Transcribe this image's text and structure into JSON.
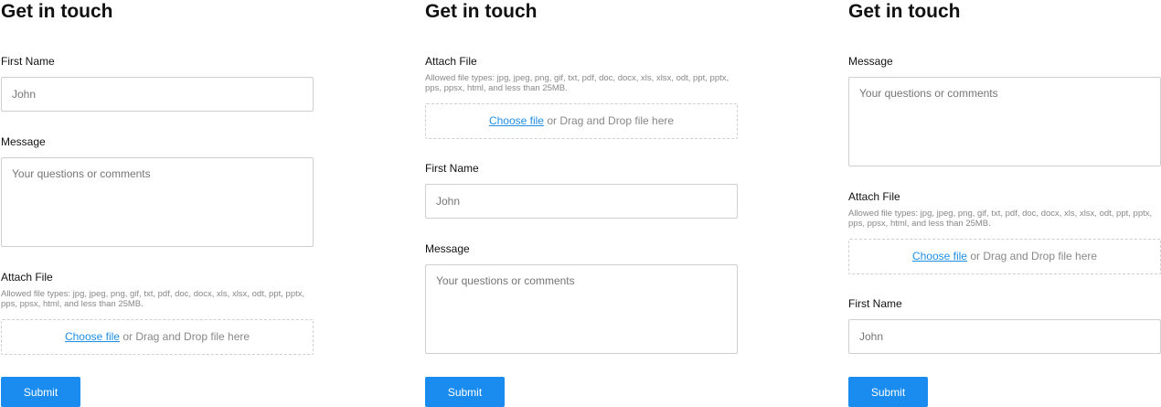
{
  "forms": [
    {
      "title": "Get in touch",
      "first_name": {
        "label": "First Name",
        "placeholder": "John"
      },
      "message": {
        "label": "Message",
        "placeholder": "Your questions or comments"
      },
      "attach": {
        "label": "Attach File",
        "allowed_text": "Allowed file types: jpg, jpeg, png, gif, txt, pdf, doc, docx, xls, xlsx, odt, ppt, pptx, pps, ppsx, html, and less than 25MB.",
        "choose_label": "Choose file",
        "drop_text": " or Drag and Drop file here"
      },
      "submit_label": "Submit"
    },
    {
      "title": "Get in touch",
      "first_name": {
        "label": "First Name",
        "placeholder": "John"
      },
      "message": {
        "label": "Message",
        "placeholder": "Your questions or comments"
      },
      "attach": {
        "label": "Attach File",
        "allowed_text": "Allowed file types: jpg, jpeg, png, gif, txt, pdf, doc, docx, xls, xlsx, odt, ppt, pptx, pps, ppsx, html, and less than 25MB.",
        "choose_label": "Choose file",
        "drop_text": " or Drag and Drop file here"
      },
      "submit_label": "Submit"
    },
    {
      "title": "Get in touch",
      "first_name": {
        "label": "First Name",
        "placeholder": "John"
      },
      "message": {
        "label": "Message",
        "placeholder": "Your questions or comments"
      },
      "attach": {
        "label": "Attach File",
        "allowed_text": "Allowed file types: jpg, jpeg, png, gif, txt, pdf, doc, docx, xls, xlsx, odt, ppt, pptx, pps, ppsx, html, and less than 25MB.",
        "choose_label": "Choose file",
        "drop_text": " or Drag and Drop file here"
      },
      "submit_label": "Submit"
    }
  ],
  "colors": {
    "accent": "#1a8cf0",
    "link": "#1f8ee6",
    "border": "#cfcfcf",
    "muted": "#888888"
  }
}
